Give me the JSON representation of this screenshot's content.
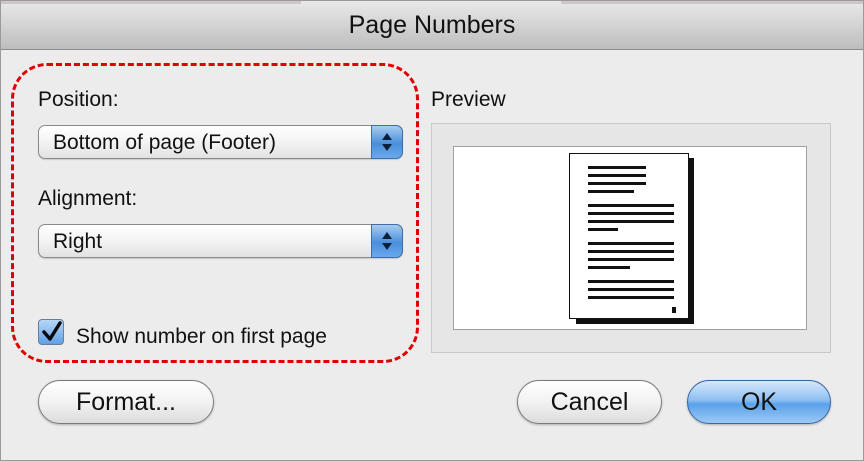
{
  "window": {
    "title": "Page Numbers"
  },
  "position": {
    "label": "Position:",
    "selected": "Bottom of page (Footer)"
  },
  "alignment": {
    "label": "Alignment:",
    "selected": "Right"
  },
  "show_first_page": {
    "label": "Show number on first page",
    "checked": true
  },
  "preview": {
    "label": "Preview"
  },
  "buttons": {
    "format": "Format...",
    "cancel": "Cancel",
    "ok": "OK"
  },
  "colors": {
    "highlight": "#e00000",
    "accent": "#4a8fdb"
  }
}
